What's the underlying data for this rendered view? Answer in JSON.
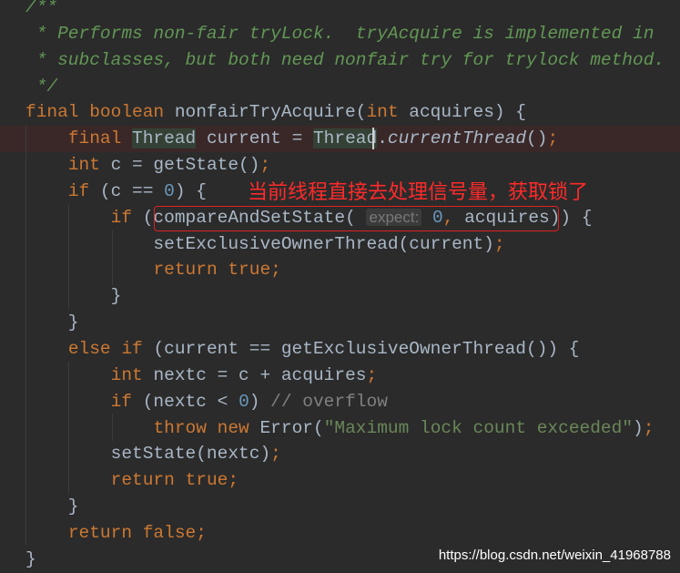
{
  "editor": {
    "lines": [
      {
        "tokens": [
          [
            "cm",
            "/**"
          ]
        ]
      },
      {
        "tokens": [
          [
            "cm",
            " * Performs non-fair tryLock.  tryAcquire is implemented in"
          ]
        ]
      },
      {
        "tokens": [
          [
            "cm",
            " * subclasses, but both need nonfair try for trylock method."
          ]
        ]
      },
      {
        "tokens": [
          [
            "cm",
            " */"
          ]
        ]
      },
      {
        "tokens": [
          [
            "kw",
            "final boolean "
          ],
          [
            "tx",
            "nonfairTryAcquire("
          ],
          [
            "kw",
            "int "
          ],
          [
            "tx",
            "acquires) {"
          ]
        ]
      },
      {
        "highlight": true,
        "tokens": [
          [
            "tx",
            "    "
          ],
          [
            "kw",
            "final "
          ],
          [
            "ref",
            "Thread"
          ],
          [
            "tx",
            " current = "
          ],
          [
            "ref",
            "Thread"
          ],
          [
            "tx",
            "."
          ],
          [
            "it",
            "currentThread"
          ],
          [
            "tx",
            "()"
          ],
          [
            "kw",
            ";"
          ]
        ]
      },
      {
        "tokens": [
          [
            "tx",
            "    "
          ],
          [
            "kw",
            "int "
          ],
          [
            "tx",
            "c = getState()"
          ],
          [
            "kw",
            ";"
          ]
        ]
      },
      {
        "tokens": [
          [
            "tx",
            "    "
          ],
          [
            "kw",
            "if "
          ],
          [
            "tx",
            "(c == "
          ],
          [
            "num",
            "0"
          ],
          [
            "tx",
            ") {"
          ]
        ]
      },
      {
        "tokens": [
          [
            "tx",
            "        "
          ],
          [
            "kw",
            "if "
          ],
          [
            "tx",
            "(compareAndSetState( "
          ],
          [
            "hint",
            "expect:"
          ],
          [
            "tx",
            " "
          ],
          [
            "num",
            "0"
          ],
          [
            "kw",
            ", "
          ],
          [
            "tx",
            "acquires)) {"
          ]
        ]
      },
      {
        "tokens": [
          [
            "tx",
            "            setExclusiveOwnerThread(current)"
          ],
          [
            "kw",
            ";"
          ]
        ]
      },
      {
        "tokens": [
          [
            "tx",
            "            "
          ],
          [
            "kw",
            "return true;"
          ]
        ]
      },
      {
        "tokens": [
          [
            "tx",
            "        }"
          ]
        ]
      },
      {
        "tokens": [
          [
            "tx",
            "    }"
          ]
        ]
      },
      {
        "tokens": [
          [
            "tx",
            "    "
          ],
          [
            "kw",
            "else if "
          ],
          [
            "tx",
            "(current == getExclusiveOwnerThread()) {"
          ]
        ]
      },
      {
        "tokens": [
          [
            "tx",
            "        "
          ],
          [
            "kw",
            "int "
          ],
          [
            "tx",
            "nextc = c + acquires"
          ],
          [
            "kw",
            ";"
          ]
        ]
      },
      {
        "tokens": [
          [
            "tx",
            "        "
          ],
          [
            "kw",
            "if "
          ],
          [
            "tx",
            "(nextc < "
          ],
          [
            "num",
            "0"
          ],
          [
            "tx",
            ") "
          ],
          [
            "lc",
            "// overflow"
          ]
        ]
      },
      {
        "tokens": [
          [
            "tx",
            "            "
          ],
          [
            "kw",
            "throw new "
          ],
          [
            "tx",
            "Error("
          ],
          [
            "str",
            "\"Maximum lock count exceeded\""
          ],
          [
            "tx",
            ")"
          ],
          [
            "kw",
            ";"
          ]
        ]
      },
      {
        "tokens": [
          [
            "tx",
            "        setState(nextc)"
          ],
          [
            "kw",
            ";"
          ]
        ]
      },
      {
        "tokens": [
          [
            "tx",
            "        "
          ],
          [
            "kw",
            "return true;"
          ]
        ]
      },
      {
        "tokens": [
          [
            "tx",
            "    }"
          ]
        ]
      },
      {
        "tokens": [
          [
            "tx",
            "    "
          ],
          [
            "kw",
            "return false;"
          ]
        ]
      },
      {
        "tokens": [
          [
            "tx",
            "}"
          ]
        ]
      }
    ]
  },
  "annotation": {
    "text": "当前线程直接去处理信号量，获取锁了",
    "color": "#ff2a2a"
  },
  "watermark": "https://blog.csdn.net/weixin_41968788",
  "colors": {
    "background": "#2b2b2b",
    "keyword": "#cc7832",
    "comment": "#629755",
    "number": "#6897bb",
    "string": "#6a8759",
    "text": "#a9b7c6"
  }
}
